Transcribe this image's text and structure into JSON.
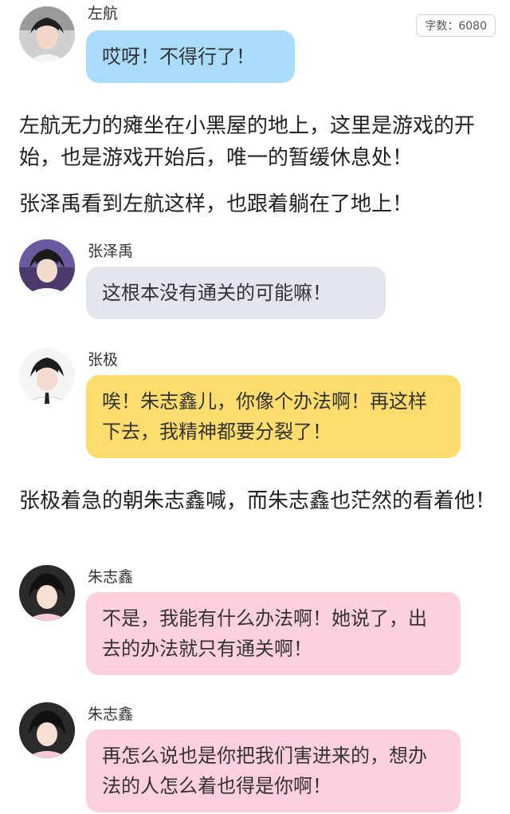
{
  "word_count": "字数：6080",
  "colors": {
    "blue_bubble": "#a8dcfa",
    "gray_bubble": "#e2e5eb",
    "yellow_bubble": "#fcdc6d",
    "pink_bubble": "#fbd0dc"
  },
  "messages": [
    {
      "speaker": "左航",
      "text": "哎呀！不得行了！",
      "bubble": "blue",
      "avatar_icon": "avatar-zuohang-icon"
    },
    {
      "speaker": "张泽禹",
      "text": "这根本没有通关的可能嘛！",
      "bubble": "gray",
      "avatar_icon": "avatar-zhangzeyu-icon"
    },
    {
      "speaker": "张极",
      "text": "唉！朱志鑫儿，你像个办法啊！再这样下去，我精神都要分裂了！",
      "bubble": "yellow",
      "avatar_icon": "avatar-zhangji-icon"
    },
    {
      "speaker": "朱志鑫",
      "text": "不是，我能有什么办法啊！她说了，出去的办法就只有通关啊！",
      "bubble": "pink",
      "avatar_icon": "avatar-zhuzhixin-icon"
    },
    {
      "speaker": "朱志鑫",
      "text": "再怎么说也是你把我们害进来的，想办法的人怎么着也得是你啊！",
      "bubble": "pink",
      "avatar_icon": "avatar-zhuzhixin-icon"
    }
  ],
  "narration": [
    "左航无力的瘫坐在小黑屋的地上，这里是游戏的开始，也是游戏开始后，唯一的暂缓休息处！",
    "张泽禹看到左航这样，也跟着躺在了地上！",
    "张极着急的朝朱志鑫喊，而朱志鑫也茫然的看着他！"
  ]
}
